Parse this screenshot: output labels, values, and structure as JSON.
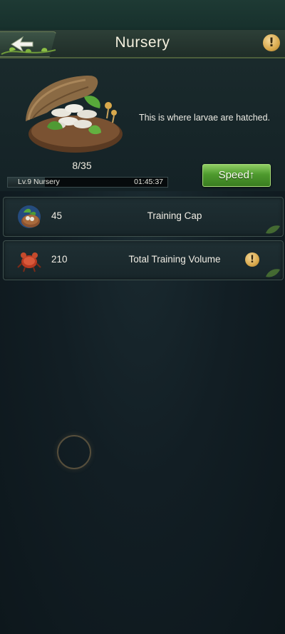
{
  "header": {
    "title": "Nursery",
    "back_icon": "back-arrow-icon",
    "info_icon": "info-icon",
    "info_glyph": "!"
  },
  "building": {
    "image": "larvae-nest-image",
    "capacity_text": "8/35",
    "capacity_fill": 0.23,
    "description": "This is where larvae are hatched.",
    "level_name": "Lv.9 Nursery",
    "timer": "01:45:37",
    "speed_label": "Speed↑"
  },
  "stats": [
    {
      "icon": "training-cap-icon",
      "value": "45",
      "label": "Training Cap"
    },
    {
      "icon": "total-training-volume-icon",
      "value": "210",
      "label": "Total Training Volume",
      "info_glyph": "!"
    }
  ],
  "colors": {
    "accent_green": "#4e9a2e",
    "gold": "#d9a94c",
    "background": "#121e24"
  }
}
